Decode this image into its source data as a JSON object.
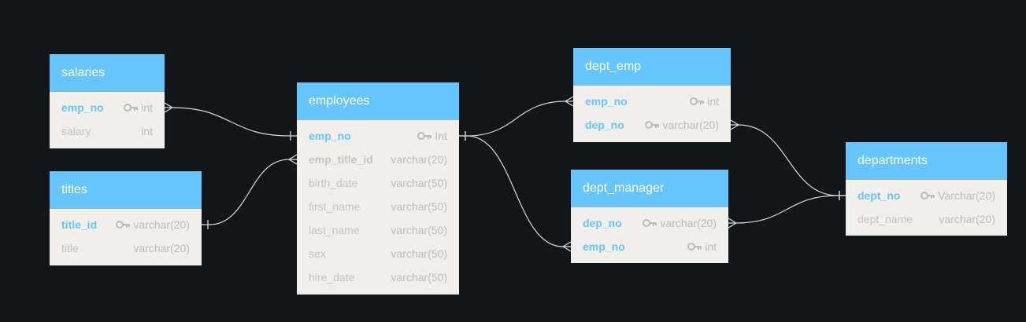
{
  "colors": {
    "background": "#131619",
    "header": "#67c5fd",
    "body": "#f0efec",
    "pk_text": "#67c5fd",
    "field_text": "#c4c3c0",
    "type_text": "#bdbcb9",
    "link": "#d7d7d7"
  },
  "tables": {
    "salaries": {
      "name": "salaries",
      "columns": [
        {
          "name": "emp_no",
          "type": "int",
          "key": true
        },
        {
          "name": "salary",
          "type": "int",
          "key": false
        }
      ]
    },
    "titles": {
      "name": "titles",
      "columns": [
        {
          "name": "title_id",
          "type": "varchar(20)",
          "key": true
        },
        {
          "name": "title",
          "type": "varchar(20)",
          "key": false
        }
      ]
    },
    "employees": {
      "name": "employees",
      "columns": [
        {
          "name": "emp_no",
          "type": "Int",
          "key": true
        },
        {
          "name": "emp_title_id",
          "type": "varchar(20)",
          "key": false,
          "bold": true
        },
        {
          "name": "birth_date",
          "type": "varchar(50)",
          "key": false
        },
        {
          "name": "first_name",
          "type": "varchar(50)",
          "key": false
        },
        {
          "name": "last_name",
          "type": "varchar(50)",
          "key": false
        },
        {
          "name": "sex",
          "type": "varchar(50)",
          "key": false
        },
        {
          "name": "hire_date",
          "type": "varchar(50)",
          "key": false
        }
      ]
    },
    "dept_emp": {
      "name": "dept_emp",
      "columns": [
        {
          "name": "emp_no",
          "type": "int",
          "key": true
        },
        {
          "name": "dep_no",
          "type": "varchar(20)",
          "key": true
        }
      ]
    },
    "dept_manager": {
      "name": "dept_manager",
      "columns": [
        {
          "name": "dep_no",
          "type": "varchar(20)",
          "key": true
        },
        {
          "name": "emp_no",
          "type": "int",
          "key": true
        }
      ]
    },
    "departments": {
      "name": "departments",
      "columns": [
        {
          "name": "dept_no",
          "type": "Varchar(20)",
          "key": true
        },
        {
          "name": "dept_name",
          "type": "varchar(20)",
          "key": false
        }
      ]
    }
  },
  "relationships": [
    {
      "from": "salaries.emp_no",
      "to": "employees.emp_no",
      "from_end": "many",
      "to_end": "one"
    },
    {
      "from": "titles.title_id",
      "to": "employees.emp_title_id",
      "from_end": "one",
      "to_end": "many"
    },
    {
      "from": "employees.emp_no",
      "to": "dept_emp.emp_no",
      "from_end": "one",
      "to_end": "many"
    },
    {
      "from": "employees.emp_no",
      "to": "dept_manager.emp_no",
      "from_end": "one",
      "to_end": "many"
    },
    {
      "from": "dept_emp.dep_no",
      "to": "departments.dept_no",
      "from_end": "many",
      "to_end": "one"
    },
    {
      "from": "dept_manager.dep_no",
      "to": "departments.dept_no",
      "from_end": "many",
      "to_end": "one"
    }
  ]
}
